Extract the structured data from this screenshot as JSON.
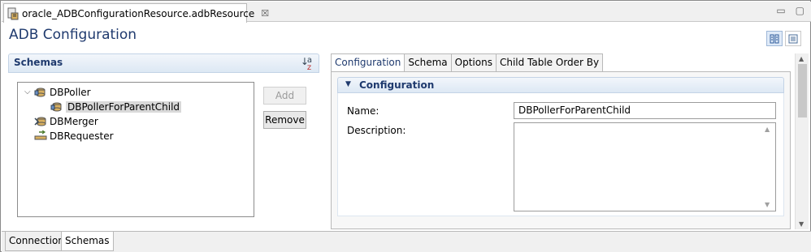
{
  "editor": {
    "file_title": "oracle_ADBConfigurationResource.adbResource",
    "close_glyph": "☒",
    "minimize_glyph": "▭",
    "maximize_glyph": "▢"
  },
  "page_title": "ADB Configuration",
  "schemas_section": {
    "title": "Schemas",
    "sort_glyph_top": "a",
    "sort_glyph_bottom": "z",
    "tree": [
      {
        "label": "DBPoller",
        "expanded": true,
        "level": 0
      },
      {
        "label": "DBPollerForParentChild",
        "level": 1,
        "selected": true
      },
      {
        "label": "DBMerger",
        "level": 0
      },
      {
        "label": "DBRequester",
        "level": 0
      }
    ],
    "add_button": "Add",
    "remove_button": "Remove"
  },
  "tabs": [
    "Configuration",
    "Schema",
    "Options",
    "Child Table Order By"
  ],
  "active_tab": "Configuration",
  "configuration": {
    "section_title": "Configuration",
    "name_label": "Name:",
    "name_value": "DBPollerForParentChild",
    "description_label": "Description:",
    "description_value": ""
  },
  "bottom_tabs": [
    "Connection",
    "Schemas"
  ],
  "active_bottom_tab": "Schemas",
  "colors": {
    "accent": "#1f3a6e",
    "section_header": "#dde8f4",
    "selection": "#d9d9d9"
  }
}
